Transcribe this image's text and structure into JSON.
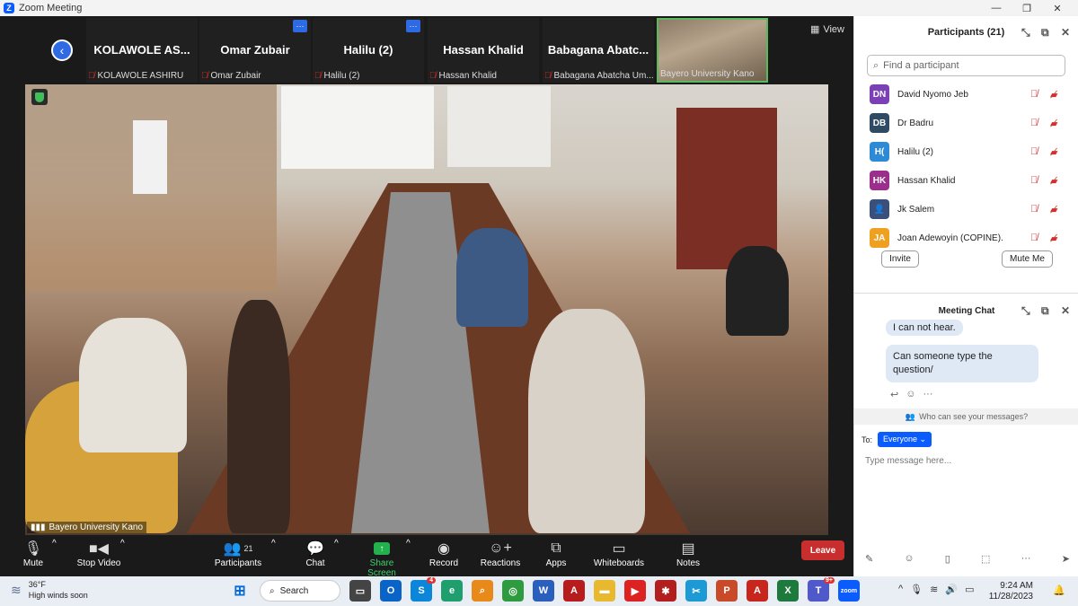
{
  "window": {
    "title": "Zoom Meeting"
  },
  "strip": {
    "tiles": [
      {
        "name": "KOLAWOLE AS...",
        "label": "KOLAWOLE ASHIRU",
        "more": false
      },
      {
        "name": "Omar Zubair",
        "label": "Omar Zubair",
        "more": true
      },
      {
        "name": "Halilu (2)",
        "label": "Halilu (2)",
        "more": true
      },
      {
        "name": "Hassan Khalid",
        "label": "Hassan Khalid",
        "more": false
      },
      {
        "name": "Babagana Abatc...",
        "label": "Babagana Abatcha Um...",
        "more": false
      },
      {
        "name": "",
        "label": "Bayero University Kano",
        "more": false
      }
    ],
    "view_label": "View"
  },
  "video": {
    "label": "Bayero University Kano"
  },
  "toolbar": {
    "mute": "Mute",
    "stop_video": "Stop Video",
    "participants": "Participants",
    "participants_count": "21",
    "chat": "Chat",
    "share_screen": "Share Screen",
    "record": "Record",
    "reactions": "Reactions",
    "apps": "Apps",
    "whiteboards": "Whiteboards",
    "notes": "Notes",
    "leave": "Leave"
  },
  "participants_panel": {
    "title": "Participants (21)",
    "search_placeholder": "Find a participant",
    "people": [
      {
        "initials": "DN",
        "name": "David Nyomo Jeb",
        "color": "#7b3fb6"
      },
      {
        "initials": "DB",
        "name": "Dr Badru",
        "color": "#2f4b63"
      },
      {
        "initials": "H(",
        "name": "Halilu (2)",
        "color": "#2f8ad6"
      },
      {
        "initials": "HK",
        "name": "Hassan Khalid",
        "color": "#9b2f8c"
      },
      {
        "initials": "",
        "name": "Jk Salem",
        "color": "#3a4f7a"
      },
      {
        "initials": "JA",
        "name": "Joan Adewoyin (COPINE).",
        "color": "#f0a020"
      }
    ],
    "invite": "Invite",
    "mute_me": "Mute Me"
  },
  "chat": {
    "title": "Meeting Chat",
    "messages": [
      "I can not hear.",
      "Can someone type the question/"
    ],
    "who_can_see": "Who can see your messages?",
    "to_label": "To:",
    "to_value": "Everyone",
    "input_placeholder": "Type message here..."
  },
  "taskbar": {
    "temperature": "36°F",
    "weather_note": "High winds soon",
    "search": "Search",
    "time": "9:24 AM",
    "date": "11/28/2023",
    "outlook_badge": "4",
    "teams_badge": "9+"
  }
}
